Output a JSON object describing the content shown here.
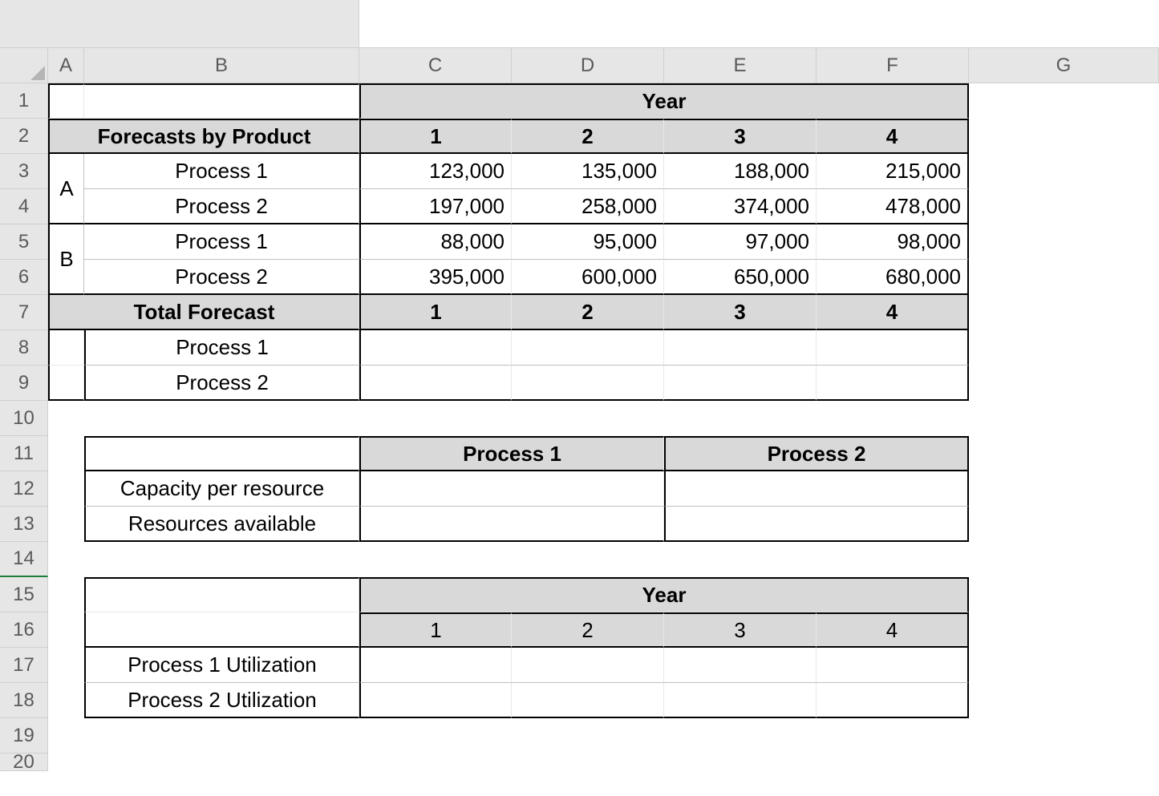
{
  "columns": [
    "A",
    "B",
    "C",
    "D",
    "E",
    "F",
    "G"
  ],
  "rows": [
    "1",
    "2",
    "3",
    "4",
    "5",
    "6",
    "7",
    "8",
    "9",
    "10",
    "11",
    "12",
    "13",
    "14",
    "15",
    "16",
    "17",
    "18",
    "19",
    "20"
  ],
  "headers": {
    "year": "Year",
    "forecasts_by_product": "Forecasts by Product",
    "total_forecast": "Total Forecast",
    "col_years": [
      "1",
      "2",
      "3",
      "4"
    ],
    "process1_hdr": "Process 1",
    "process2_hdr": "Process 2"
  },
  "products": {
    "a_label": "A",
    "b_label": "B"
  },
  "row_labels": {
    "process1": "Process 1",
    "process2": "Process 2",
    "cap_per_resource": "Capacity per resource",
    "resources_available": "Resources available",
    "p1_util": "Process 1 Utilization",
    "p2_util": "Process 2 Utilization"
  },
  "forecast": {
    "A": {
      "process1": [
        "123,000",
        "135,000",
        "188,000",
        "215,000"
      ],
      "process2": [
        "197,000",
        "258,000",
        "374,000",
        "478,000"
      ]
    },
    "B": {
      "process1": [
        "88,000",
        "95,000",
        "97,000",
        "98,000"
      ],
      "process2": [
        "395,000",
        "600,000",
        "650,000",
        "680,000"
      ]
    }
  }
}
